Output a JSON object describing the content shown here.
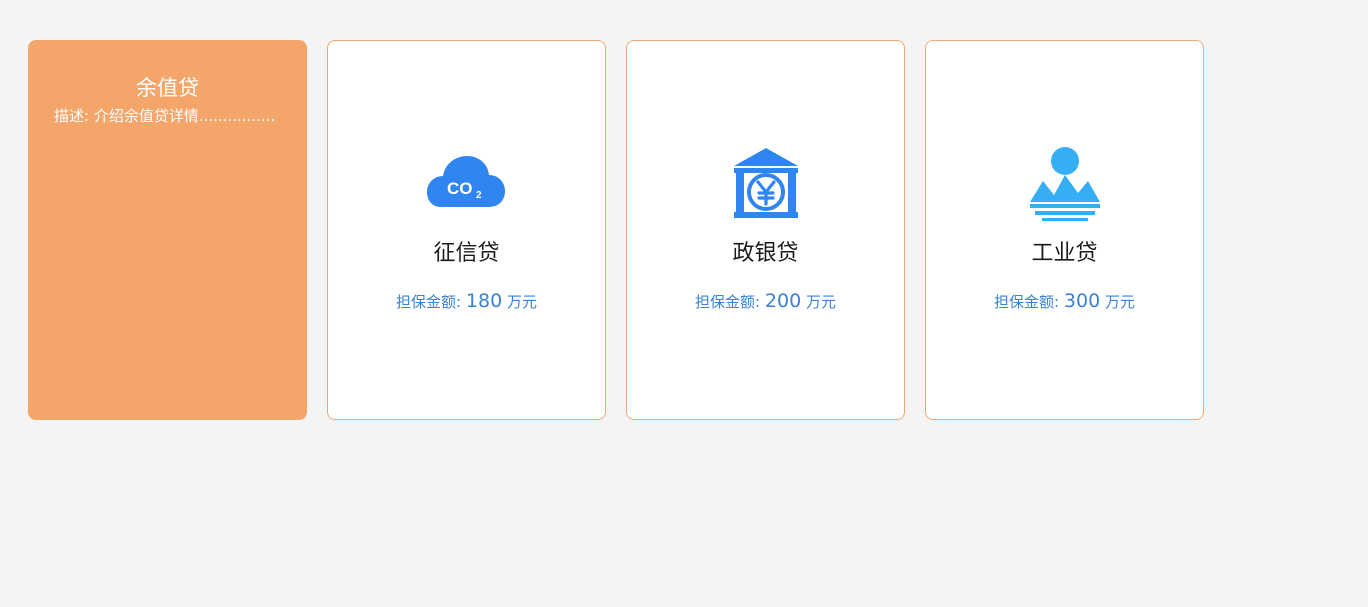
{
  "products": [
    {
      "title": "余值贷",
      "description": "描述: 介绍余值贷详情................",
      "active": true
    },
    {
      "title": "征信贷",
      "amount_label": "担保金额:",
      "amount_value": "180",
      "amount_unit": "万元",
      "icon": "co2-cloud-icon",
      "icon_text": "CO2",
      "icon_color": "#2f86f0"
    },
    {
      "title": "政银贷",
      "amount_label": "担保金额:",
      "amount_value": "200",
      "amount_unit": "万元",
      "icon": "bank-yuan-icon",
      "icon_text": "¥",
      "icon_color": "#2f86f0"
    },
    {
      "title": "工业贷",
      "amount_label": "担保金额:",
      "amount_value": "300",
      "amount_unit": "万元",
      "icon": "sun-mountain-icon",
      "icon_color": "#35aef5"
    }
  ],
  "colors": {
    "accent": "#f4a56a",
    "border": "#f0a877",
    "amount": "#3b82d6",
    "background": "#f4f4f5"
  }
}
